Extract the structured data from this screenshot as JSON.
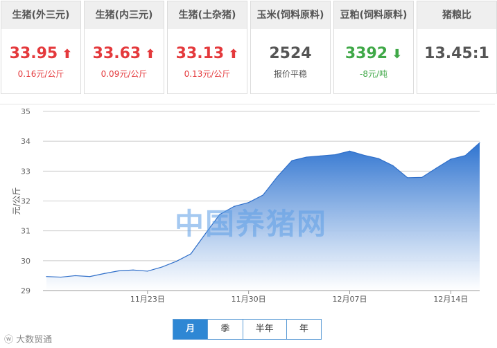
{
  "cards": [
    {
      "label": "生猪(外三元)",
      "value": "33.95",
      "arrow": "🡑",
      "sub": "0.16元/公斤",
      "trend": "up"
    },
    {
      "label": "生猪(内三元)",
      "value": "33.63",
      "arrow": "🡑",
      "sub": "0.09元/公斤",
      "trend": "up"
    },
    {
      "label": "生猪(土杂猪)",
      "value": "33.13",
      "arrow": "🡑",
      "sub": "0.13元/公斤",
      "trend": "up"
    },
    {
      "label": "玉米(饲料原料)",
      "value": "2524",
      "arrow": "",
      "sub": "报价平稳",
      "trend": "flat"
    },
    {
      "label": "豆粕(饲料原料)",
      "value": "3392",
      "arrow": "🡓",
      "sub": "-8元/吨",
      "trend": "down"
    },
    {
      "label": "猪粮比",
      "value": "13.45:1",
      "arrow": "",
      "sub": "",
      "trend": "flat"
    }
  ],
  "tabs": [
    "月",
    "季",
    "半年",
    "年"
  ],
  "active_tab": "月",
  "watermark": "中国养猪网",
  "weibo_tag": "大数贸通",
  "colors": {
    "up": "#e4393c",
    "down": "#3fa847",
    "accent": "#2e87d4",
    "line": "#2e6ec9"
  },
  "chart_data": {
    "type": "area",
    "ylabel": "元/公斤",
    "ylim": [
      29,
      35
    ],
    "yticks": [
      29,
      30,
      31,
      32,
      33,
      34,
      35
    ],
    "xticks": [
      {
        "label": "11月23日",
        "day": 7
      },
      {
        "label": "11月30日",
        "day": 14
      },
      {
        "label": "12月07日",
        "day": 21
      },
      {
        "label": "12月14日",
        "day": 28
      }
    ],
    "x": [
      0,
      1,
      2,
      3,
      4,
      5,
      6,
      7,
      8,
      9,
      10,
      11,
      12,
      13,
      14,
      15,
      16,
      17,
      18,
      19,
      20,
      21,
      22,
      23,
      24,
      25,
      26,
      27,
      28,
      29,
      30
    ],
    "values": [
      29.47,
      29.45,
      29.5,
      29.47,
      29.57,
      29.66,
      29.69,
      29.65,
      29.79,
      29.98,
      30.23,
      30.9,
      31.55,
      31.82,
      31.95,
      32.2,
      32.82,
      33.35,
      33.47,
      33.51,
      33.55,
      33.67,
      33.53,
      33.42,
      33.18,
      32.78,
      32.79,
      33.1,
      33.4,
      33.52,
      33.95
    ]
  }
}
